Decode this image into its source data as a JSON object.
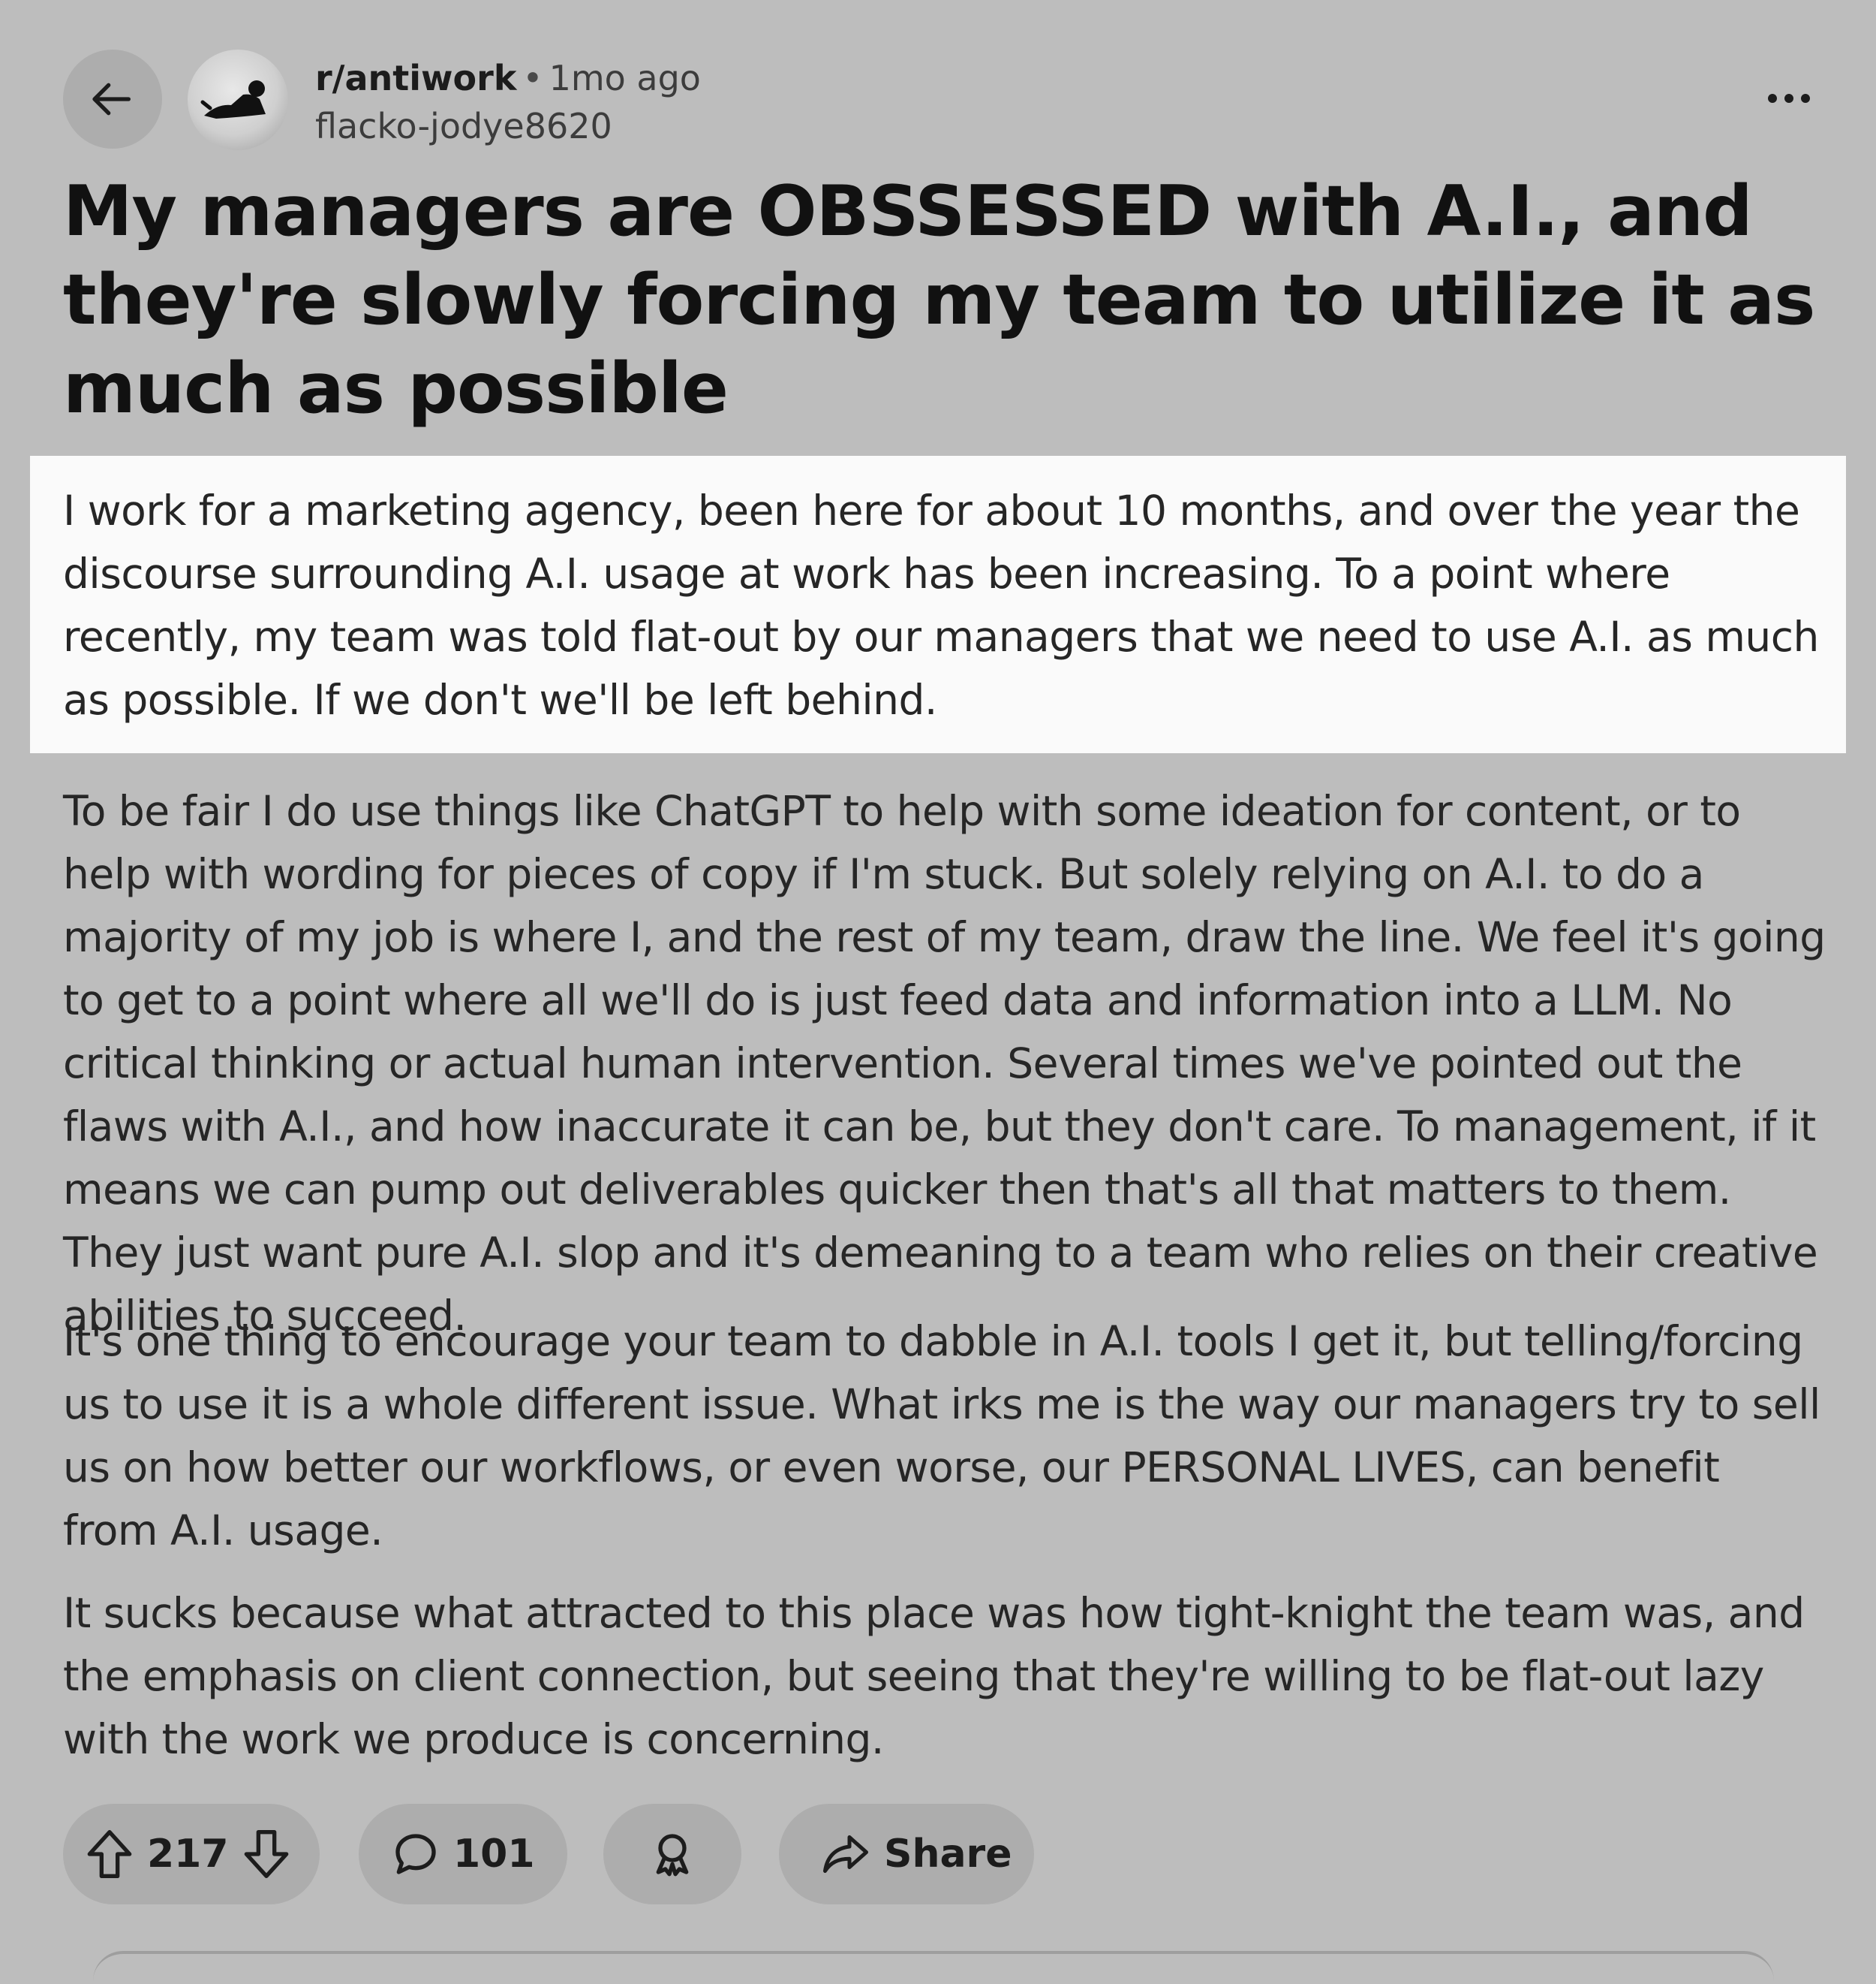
{
  "post": {
    "subreddit": "r/antiwork",
    "separator": "•",
    "time": "1mo ago",
    "author": "flacko-jodye8620",
    "title": "My managers are OBSSESSED with A.I., and they're slowly forcing my team to utilize it as much as possible",
    "paragraphs": [
      "I work for a marketing agency, been here for about 10 months, and over the year the discourse surrounding A.I. usage at work has been increasing. To a point where recently, my team was told flat-out by our managers that we need to use A.I. as much as possible. If we don't we'll be left behind.",
      "To be fair I do use things like ChatGPT to help with some ideation for content, or to help with wording for pieces of copy if I'm stuck. But solely relying on A.I. to do a majority of my job is where I, and the rest of my team, draw the line. We feel it's going to get to a point where all we'll do is just feed data and information into a LLM. No critical thinking or actual human intervention. Several times we've pointed out the flaws with A.I., and how inaccurate it can be, but they don't care. To management, if it means we can pump out deliverables quicker then that's all that matters to them. They just want pure A.I. slop and it's demeaning to a team who relies on their creative abilities to succeed.",
      "It's one thing to encourage your team to dabble in A.I. tools I get it, but telling/forcing us to use it is a whole different issue. What irks me is the way our managers try to sell us on how better our workflows, or even worse, our PERSONAL LIVES, can benefit from A.I. usage.",
      "It sucks because what attracted to this place was how tight-knight the team was, and the emphasis on client connection, but seeing that they're willing to be flat-out lazy with the work we produce is concerning."
    ]
  },
  "actions": {
    "vote_count": "217",
    "comment_count": "101",
    "share_label": "Share"
  },
  "icons": {
    "back": "arrow-left-icon",
    "more": "ellipsis-icon",
    "upvote": "arrow-up-icon",
    "downvote": "arrow-down-icon",
    "comment": "speech-bubble-icon",
    "award": "award-icon",
    "share": "share-arrow-icon"
  },
  "colors": {
    "background": "#bdbdbd",
    "pill": "#adadad",
    "highlight": "#fafafa",
    "text": "#1c1c1c"
  }
}
